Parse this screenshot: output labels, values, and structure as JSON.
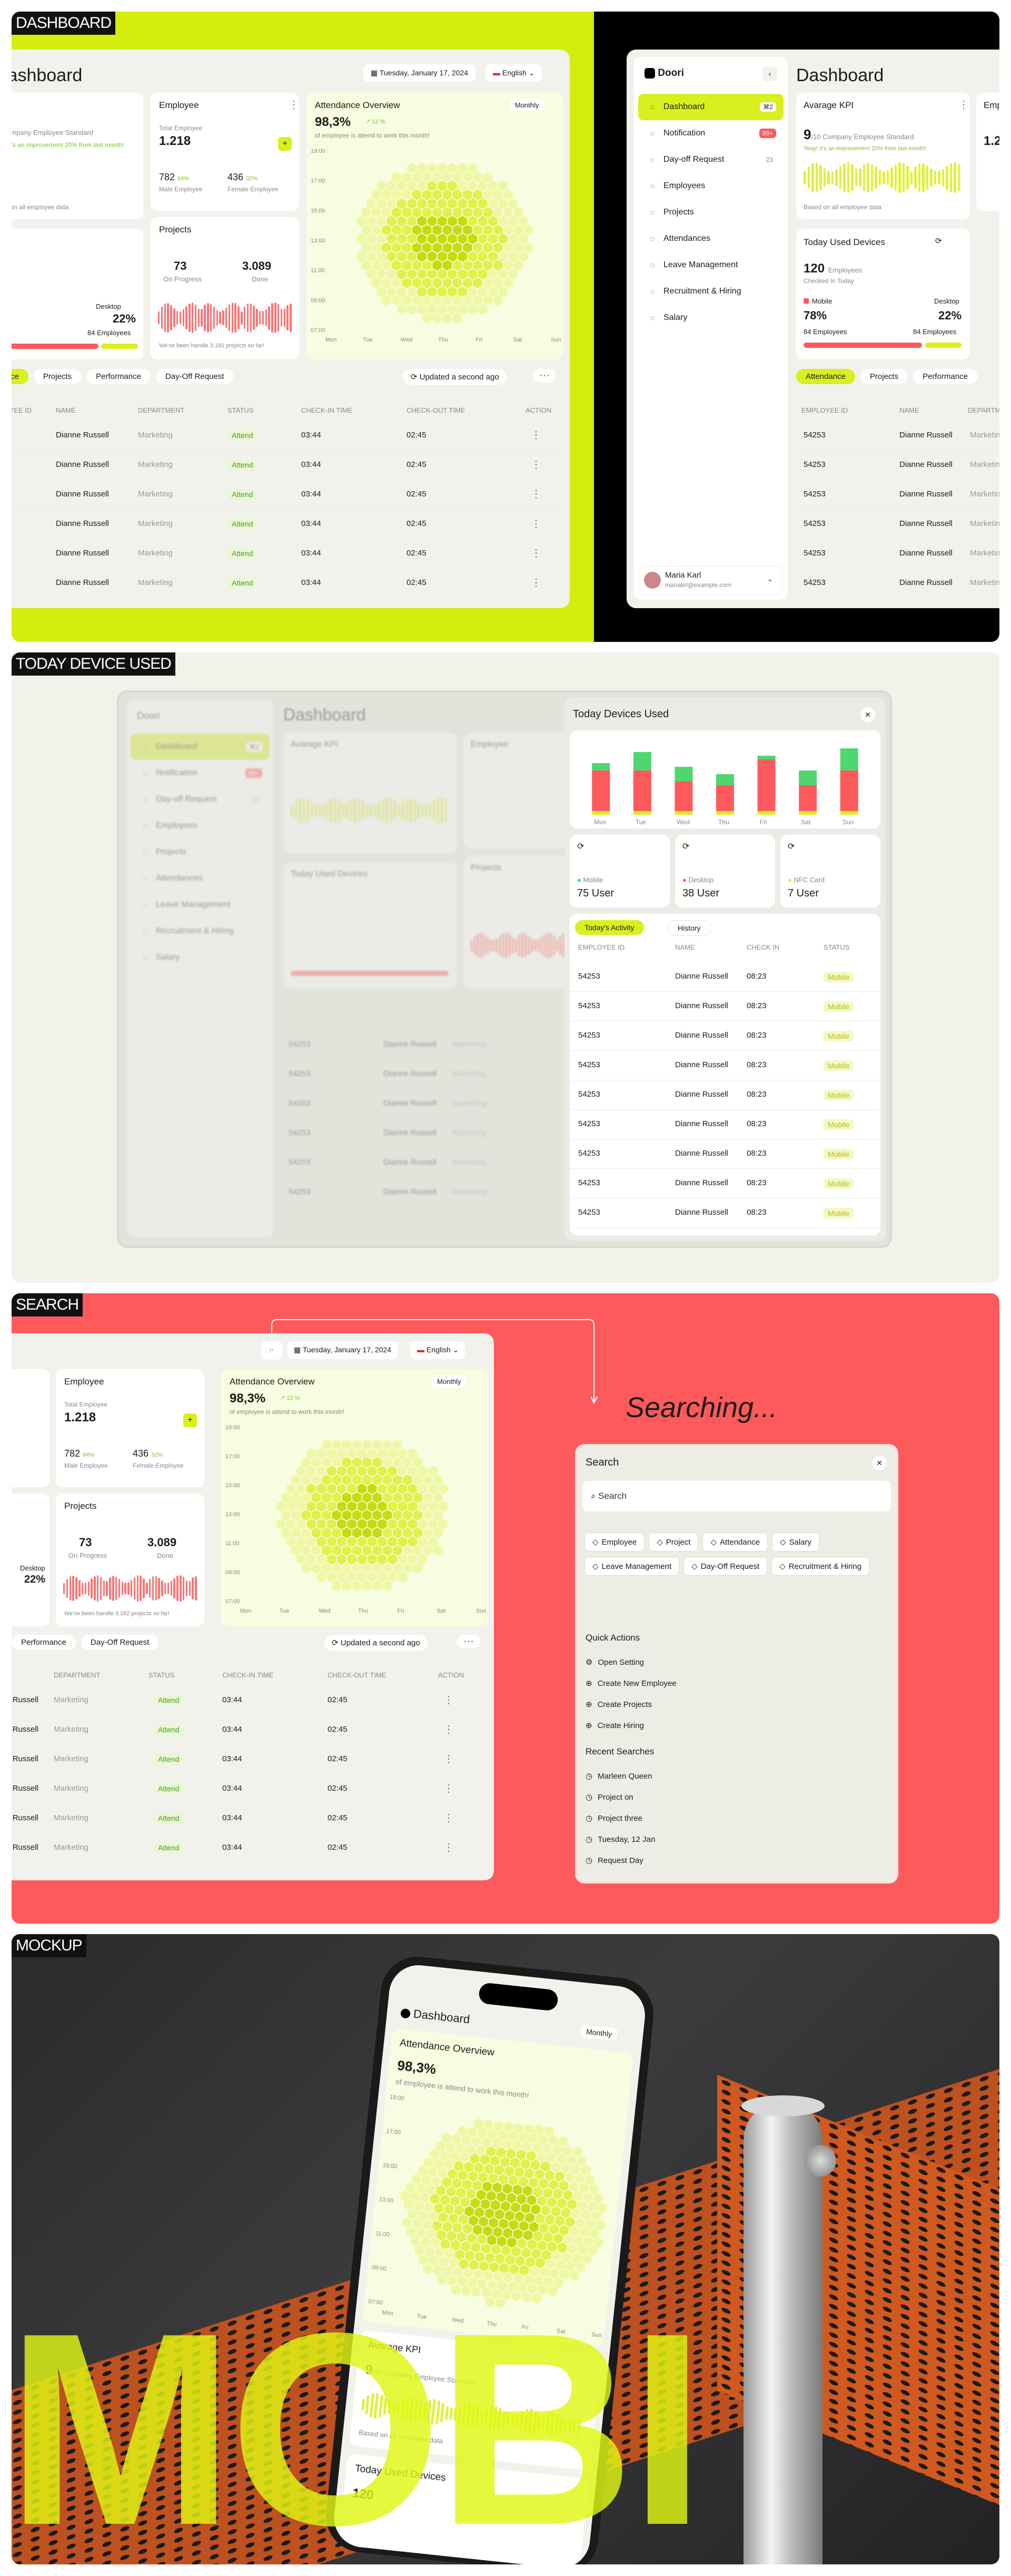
{
  "sections": {
    "dashboard": "DASHBOARD",
    "devices": "TODAY DEVICE USED",
    "search": "SEARCH",
    "mockup": "MOCKUP"
  },
  "app": {
    "brand": "Doori",
    "title": "Dashboard",
    "date": "Tuesday, January 17, 2024",
    "language": "English",
    "user_name": "Maria Karl",
    "user_email": "mariakrl@example.com"
  },
  "sidebar": [
    {
      "label": "Dashboard",
      "badge": "⌘2",
      "icon": "dashboard-icon"
    },
    {
      "label": "Notification",
      "badge": "99+",
      "icon": "bell-icon"
    },
    {
      "label": "Day-off Request",
      "badge": "23",
      "icon": "calendar-icon"
    },
    {
      "label": "Employees",
      "badge": "",
      "icon": "user-icon"
    },
    {
      "label": "Projects",
      "badge": "",
      "icon": "folder-icon"
    },
    {
      "label": "Attendances",
      "badge": "",
      "icon": "attendance-icon"
    },
    {
      "label": "Leave Management",
      "badge": "",
      "icon": "leave-icon"
    },
    {
      "label": "Recruitment & Hiring",
      "badge": "",
      "icon": "recruit-icon"
    },
    {
      "label": "Salary",
      "badge": "",
      "icon": "salary-icon"
    }
  ],
  "kpi": {
    "title": "Avarage KPI",
    "value": "9",
    "sub": "/10 Company Employee Standard",
    "note": "Yeay! It's an improvement 20% from last month!",
    "footer": "Based on all employee data"
  },
  "employee": {
    "title": "Employee",
    "label": "Total Employee",
    "total": "1.218",
    "male": "782",
    "male_pct": "64%",
    "male_label": "Male Employee",
    "female": "436",
    "female_pct": "32%",
    "female_label": "Female Employee"
  },
  "projects": {
    "title": "Projects",
    "progress": "73",
    "progress_label": "On Progress",
    "done": "3.089",
    "done_label": "Done",
    "note": "We've been handle 3.182 projects so far!"
  },
  "devices_card": {
    "title": "Today Used Devices",
    "count": "120",
    "count_label": "Employees",
    "sub": "Checked In Today",
    "mobile_label": "Mobile",
    "mobile_pct": "78%",
    "mobile_emp": "84 Employees",
    "desktop_label": "Desktop",
    "desktop_pct": "22%",
    "desktop_emp": "84 Employees"
  },
  "attendance": {
    "title": "Attendance Overview",
    "period": "Monthly",
    "pct": "98,3%",
    "delta": "↗ 12 %",
    "sub": "of employee is attend to work this month!",
    "hours": [
      "19:00",
      "17:00",
      "15:00",
      "13:00",
      "11:00",
      "09:00",
      "07:00"
    ],
    "days": [
      "Mon",
      "Tue",
      "Wed",
      "Thu",
      "Fri",
      "Sat",
      "Sun"
    ]
  },
  "tabs": [
    "Attendance",
    "Projects",
    "Performance",
    "Day-Off Request"
  ],
  "updated": "Updated a second ago",
  "table_headers": [
    "EMPLOYEE ID",
    "NAME",
    "DEPARTMENT",
    "STATUS",
    "CHECK-IN TIME",
    "CHECK-OUT TIME",
    "ACTION"
  ],
  "table_rows": [
    {
      "id": "54253",
      "name": "Dianne Russell",
      "dept": "Marketing",
      "status": "Attend",
      "in": "03:44",
      "out": "02:45"
    },
    {
      "id": "54253",
      "name": "Dianne Russell",
      "dept": "Marketing",
      "status": "Attend",
      "in": "03:44",
      "out": "02:45"
    },
    {
      "id": "54253",
      "name": "Dianne Russell",
      "dept": "Marketing",
      "status": "Attend",
      "in": "03:44",
      "out": "02:45"
    },
    {
      "id": "54253",
      "name": "Dianne Russell",
      "dept": "Marketing",
      "status": "Attend",
      "in": "03:44",
      "out": "02:45"
    },
    {
      "id": "54253",
      "name": "Dianne Russell",
      "dept": "Marketing",
      "status": "Attend",
      "in": "03:44",
      "out": "02:45"
    },
    {
      "id": "54253",
      "name": "Dianne Russell",
      "dept": "Marketing",
      "status": "Attend",
      "in": "03:44",
      "out": "02:45"
    }
  ],
  "devices_modal": {
    "title": "Today Devices Used",
    "days": [
      "Mon",
      "Tue",
      "Wed",
      "Thu",
      "Fri",
      "Sat",
      "Sun"
    ],
    "stacks": [
      {
        "green": 0.1,
        "red": 0.55,
        "lime": 0.05
      },
      {
        "green": 0.25,
        "red": 0.55,
        "lime": 0.05
      },
      {
        "green": 0.2,
        "red": 0.4,
        "lime": 0.05
      },
      {
        "green": 0.15,
        "red": 0.35,
        "lime": 0.05
      },
      {
        "green": 0.05,
        "red": 0.7,
        "lime": 0.05
      },
      {
        "green": 0.2,
        "red": 0.35,
        "lime": 0.05
      },
      {
        "green": 0.3,
        "red": 0.55,
        "lime": 0.05
      }
    ],
    "mobile": "Mobile",
    "mobile_val": "75 User",
    "desktop": "Desktop",
    "desktop_val": "38 User",
    "nfc": "NFC Card",
    "nfc_val": "7 User",
    "tab_active": "Today's Activity",
    "tab_other": "History",
    "headers": [
      "EMPLOYEE ID",
      "NAME",
      "CHECK IN",
      "STATUS"
    ],
    "row_id": "54253",
    "row_name": "Dianne Russell",
    "row_time": "08:23",
    "row_status": "Mobile"
  },
  "search": {
    "heading": "Searching...",
    "modal_title": "Search",
    "placeholder": "Search",
    "chips": [
      "Employee",
      "Project",
      "Attendance",
      "Salary",
      "Leave Management",
      "Day-Off Request",
      "Recruitment & Hiring"
    ],
    "quick_title": "Quick Actions",
    "quick": [
      "Open Setting",
      "Create New Employee",
      "Create Projects",
      "Create Hiring"
    ],
    "recent_title": "Recent Searches",
    "recent": [
      "Marleen Queen",
      "Project on",
      "Project three",
      "Tuesday, 12 Jan",
      "Request Day"
    ]
  },
  "mockup": {
    "big_text": "MOBI",
    "phone_title": "Dashboard",
    "phone_period": "Monthly",
    "phone_att_title": "Attendance Overview",
    "phone_pct": "98,3%",
    "phone_sub": "of employee is attend to work this month!",
    "kpi_title": "Avarage KPI",
    "kpi_sub": "/10 Company Employee Standard",
    "kpi_footer": "Based on all employee data",
    "dev_title": "Today Used Devices",
    "dev_count": "120"
  },
  "colors": {
    "lime": "#d9ef1e",
    "coral": "#fe5a5c",
    "dark": "#000000",
    "green": "#4fd66e",
    "red": "#fe5a5c"
  }
}
